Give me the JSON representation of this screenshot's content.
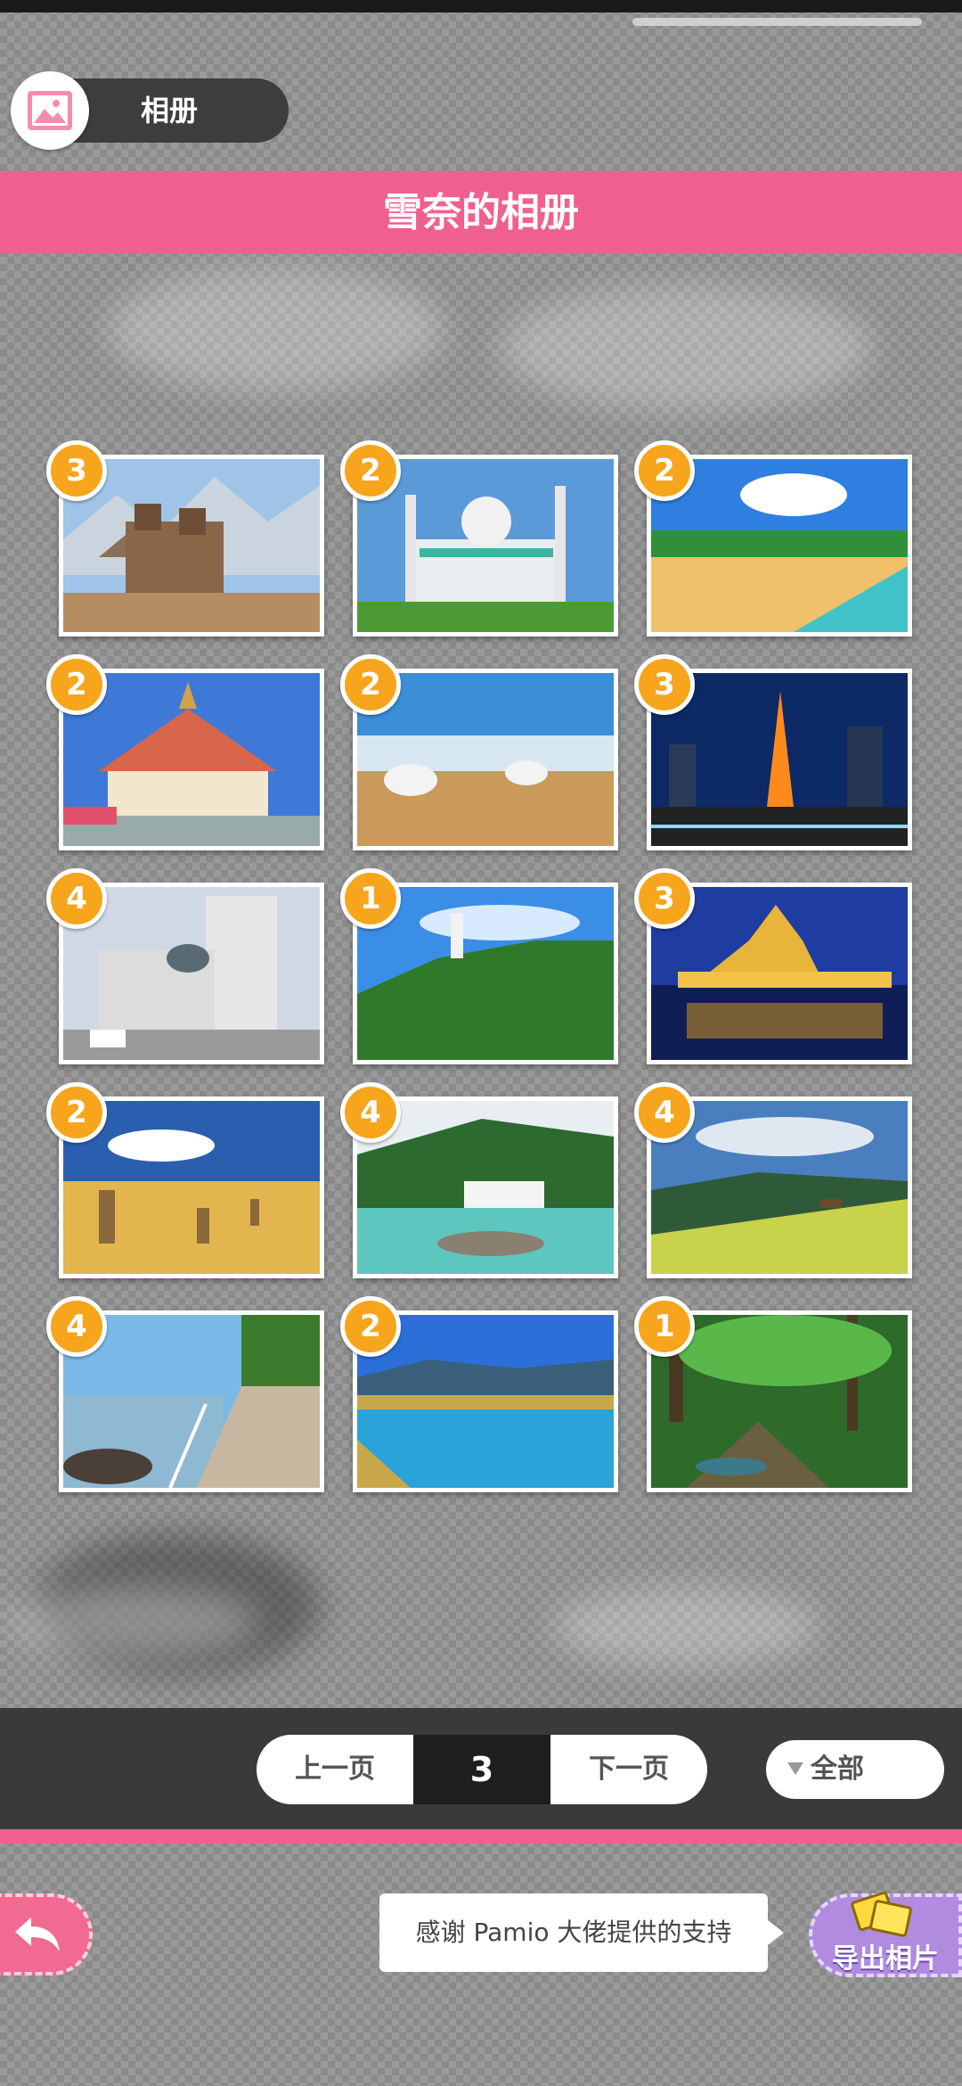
{
  "header": {
    "title": "相册",
    "icon": "gallery-icon"
  },
  "banner": {
    "title": "雪奈的相册"
  },
  "photos": [
    {
      "count": "3",
      "scene": "mountain-ruins"
    },
    {
      "count": "2",
      "scene": "mosque"
    },
    {
      "count": "2",
      "scene": "beach"
    },
    {
      "count": "2",
      "scene": "temple"
    },
    {
      "count": "2",
      "scene": "yurts"
    },
    {
      "count": "3",
      "scene": "tower-night"
    },
    {
      "count": "4",
      "scene": "city-buildings"
    },
    {
      "count": "1",
      "scene": "hill-lighthouse"
    },
    {
      "count": "3",
      "scene": "golden-palace-night"
    },
    {
      "count": "2",
      "scene": "desert-pinnacles"
    },
    {
      "count": "4",
      "scene": "waterfall-river"
    },
    {
      "count": "4",
      "scene": "meadow-horse"
    },
    {
      "count": "4",
      "scene": "coast-road"
    },
    {
      "count": "2",
      "scene": "lake-plateau"
    },
    {
      "count": "1",
      "scene": "forest-stream"
    }
  ],
  "pager": {
    "prev_label": "上一页",
    "page": "3",
    "next_label": "下一页",
    "filter_label": "全部"
  },
  "footer": {
    "tooltip": "感谢 Pamio 大佬提供的支持",
    "export_label": "导出相片"
  },
  "colors": {
    "accent_pink": "#f0608e",
    "badge_orange": "#f7a51c",
    "export_purple": "#b08be0"
  }
}
